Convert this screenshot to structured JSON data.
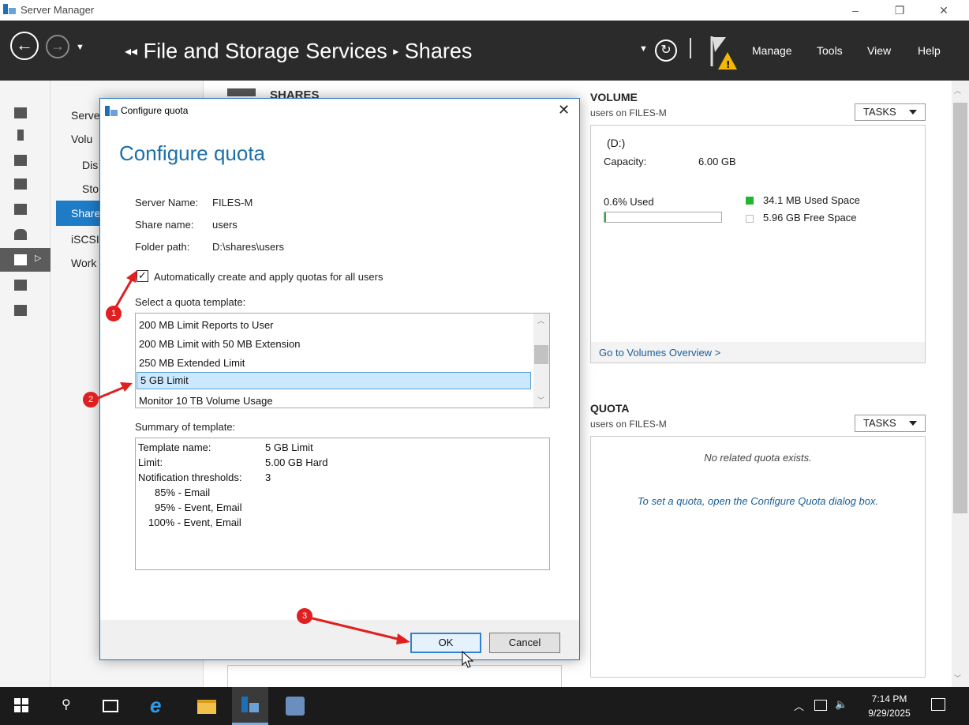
{
  "window": {
    "title": "Server Manager",
    "controls": [
      "–",
      "❐",
      "✕"
    ]
  },
  "header": {
    "back_arrows": "◂◂",
    "section": "File and Storage Services",
    "separator": "▸",
    "page": "Shares",
    "menu": [
      "Manage",
      "Tools",
      "View",
      "Help"
    ]
  },
  "nav": {
    "items": [
      "Serve",
      "Volu",
      "Dis",
      "Sto",
      "Share",
      "iSCSI",
      "Work"
    ]
  },
  "center": {
    "title": "SHARES"
  },
  "volume": {
    "title": "VOLUME",
    "subtitle": "users on FILES-M",
    "tasks": "TASKS",
    "drive": "(D:)",
    "capacity_label": "Capacity:",
    "capacity_value": "6.00 GB",
    "used_pct": "0.6% Used",
    "used_fraction": 0.006,
    "used_legend": "34.1 MB Used Space",
    "free_legend": "5.96 GB Free Space",
    "overview_link": "Go to Volumes Overview >",
    "used_color": "#1eb82e"
  },
  "quota": {
    "title": "QUOTA",
    "subtitle": "users on FILES-M",
    "tasks": "TASKS",
    "empty": "No related quota exists.",
    "hint": "To set a quota, open the Configure Quota dialog box."
  },
  "dialog": {
    "title": "Configure quota",
    "heading": "Configure quota",
    "close": "✕",
    "server_label": "Server Name:",
    "server_value": "FILES-M",
    "share_label": "Share name:",
    "share_value": "users",
    "folder_label": "Folder path:",
    "folder_value": "D:\\shares\\users",
    "auto_checkbox_label": "Automatically create and apply quotas for all users",
    "auto_checked": true,
    "template_label": "Select a quota template:",
    "templates": [
      "200 MB Limit Reports to User",
      "200 MB Limit with 50 MB Extension",
      "250 MB Extended Limit",
      "5 GB Limit",
      "Monitor 10 TB Volume Usage"
    ],
    "selected_template": "5 GB Limit",
    "summary_label": "Summary of template:",
    "summary": {
      "name_label": "Template name:",
      "name_value": "5 GB Limit",
      "limit_label": "Limit:",
      "limit_value": "5.00 GB Hard",
      "thresholds_label": "Notification thresholds:",
      "thresholds_value": "3",
      "thresholds": [
        "85% - Email",
        "95% - Event, Email",
        "100% - Event, Email"
      ]
    },
    "ok": "OK",
    "cancel": "Cancel"
  },
  "annotations": [
    "1",
    "2",
    "3"
  ],
  "taskbar": {
    "time": "7:14 PM",
    "date": "9/29/2025"
  }
}
